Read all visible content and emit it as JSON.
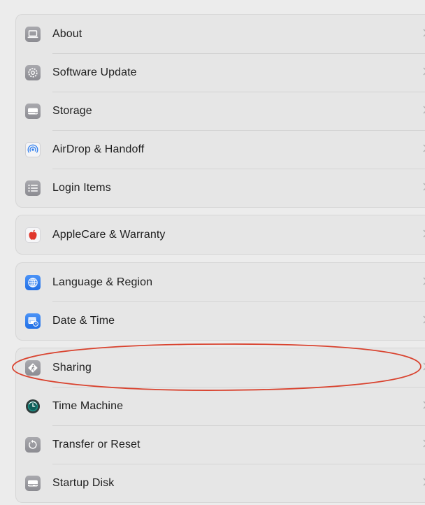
{
  "groups": [
    {
      "items": [
        {
          "label": "About",
          "icon": "laptop-icon"
        },
        {
          "label": "Software Update",
          "icon": "gear-badge-icon"
        },
        {
          "label": "Storage",
          "icon": "disk-icon"
        },
        {
          "label": "AirDrop & Handoff",
          "icon": "airdrop-icon"
        },
        {
          "label": "Login Items",
          "icon": "list-icon"
        }
      ]
    },
    {
      "items": [
        {
          "label": "AppleCare & Warranty",
          "icon": "apple-icon"
        }
      ]
    },
    {
      "items": [
        {
          "label": "Language & Region",
          "icon": "globe-icon"
        },
        {
          "label": "Date & Time",
          "icon": "calendar-clock-icon"
        }
      ]
    },
    {
      "items": [
        {
          "label": "Sharing",
          "icon": "sharing-icon"
        },
        {
          "label": "Time Machine",
          "icon": "time-machine-icon"
        },
        {
          "label": "Transfer or Reset",
          "icon": "reset-icon"
        },
        {
          "label": "Startup Disk",
          "icon": "startup-disk-icon"
        }
      ]
    }
  ],
  "annotation": {
    "target": "Sharing",
    "color": "#d9432f"
  },
  "colors": {
    "background": "#ececec",
    "group_background": "#e6e6e6",
    "label_text": "#1f1f1f",
    "chevron": "#b0b0b0",
    "blue_icon": "#2f7ff0",
    "gray_icon": "#8e8e93"
  }
}
